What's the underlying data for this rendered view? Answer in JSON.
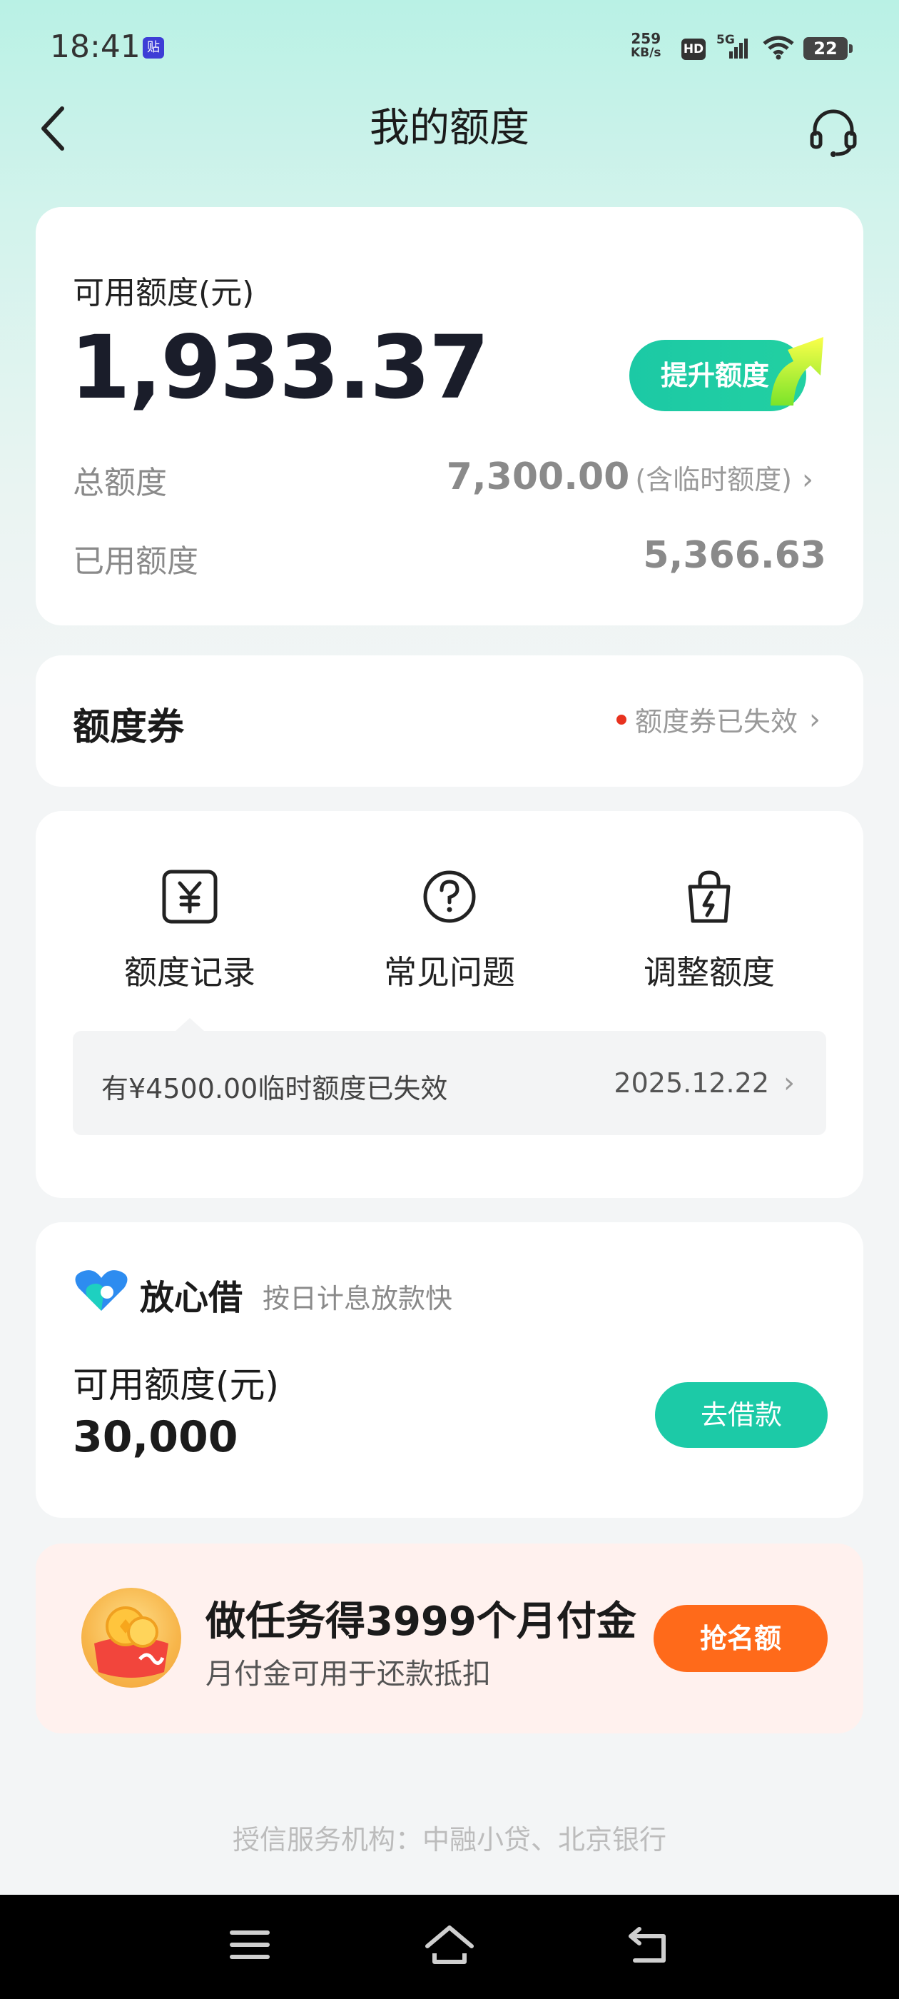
{
  "status_bar": {
    "time": "18:41",
    "app_badge": "贴",
    "net_speed_value": "259",
    "net_speed_unit": "KB/s",
    "hd": "HD",
    "signal": "5G",
    "battery": "22"
  },
  "header": {
    "title": "我的额度"
  },
  "limit_card": {
    "available_label": "可用额度(元)",
    "available_value": "1,933.37",
    "raise_button": "提升额度",
    "total_label": "总额度",
    "total_value": "7,300.00",
    "total_note": "(含临时额度)",
    "used_label": "已用额度",
    "used_value": "5,366.63"
  },
  "coupon_card": {
    "title": "额度券",
    "status": "额度券已失效"
  },
  "features": {
    "items": [
      {
        "label": "额度记录",
        "icon": "yuan-record-icon"
      },
      {
        "label": "常见问题",
        "icon": "question-icon"
      },
      {
        "label": "调整额度",
        "icon": "bag-bolt-icon"
      }
    ],
    "notice_text": "有¥4500.00临时额度已失效",
    "notice_date": "2025.12.22"
  },
  "loan_card": {
    "brand_name": "放心借",
    "brand_tagline": "按日计息放款快",
    "available_label": "可用额度(元)",
    "available_value": "30,000",
    "button": "去借款"
  },
  "promo": {
    "title": "做任务得3999个月付金",
    "subtitle": "月付金可用于还款抵扣",
    "button": "抢名额"
  },
  "footer": {
    "text": "授信服务机构：中融小贷、北京银行"
  },
  "colors": {
    "accent": "#1ccaa7",
    "promo_button": "#ff6a1a",
    "alert_dot": "#e8321f"
  }
}
